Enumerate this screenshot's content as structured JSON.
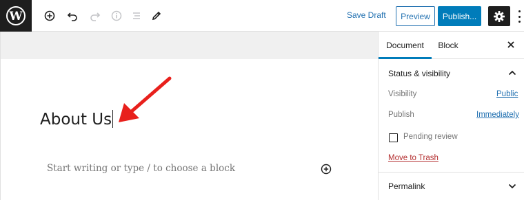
{
  "toolbar": {
    "logo_icon": "wordpress-logo-icon",
    "icons": [
      "add-block-icon",
      "undo-icon",
      "redo-icon",
      "info-icon",
      "list-view-icon",
      "edit-tools-icon"
    ],
    "save_draft_label": "Save Draft",
    "preview_label": "Preview",
    "publish_label": "Publish...",
    "settings_icon": "gear-icon",
    "more_icon": "more-vertical-icon"
  },
  "editor": {
    "title": "About Us",
    "placeholder": "Start writing or type / to choose a block",
    "annotation": "red-arrow-annotation"
  },
  "sidebar": {
    "tabs": [
      {
        "label": "Document",
        "active": true
      },
      {
        "label": "Block",
        "active": false
      }
    ],
    "status_section": {
      "heading": "Status & visibility",
      "visibility_label": "Visibility",
      "visibility_value": "Public",
      "publish_label": "Publish",
      "publish_value": "Immediately",
      "pending_review_label": "Pending review",
      "pending_review_checked": false,
      "trash_label": "Move to Trash"
    },
    "permalink_section": {
      "heading": "Permalink"
    }
  },
  "colors": {
    "accent": "#007cba",
    "link": "#2271b1",
    "danger": "#b32d2e",
    "annotation": "#e8201c"
  }
}
